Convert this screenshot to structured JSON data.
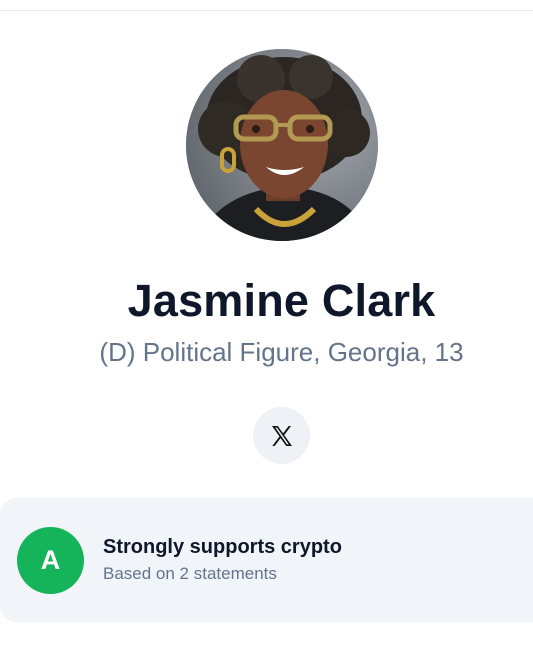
{
  "profile": {
    "name": "Jasmine Clark",
    "subtitle": "(D) Political Figure, Georgia, 13",
    "avatar_alt": "Jasmine Clark"
  },
  "social": {
    "x_icon": "x-logo-icon"
  },
  "stance": {
    "grade": "A",
    "title": "Strongly supports crypto",
    "basis": "Based on 2 statements",
    "grade_color": "#16b45a"
  }
}
